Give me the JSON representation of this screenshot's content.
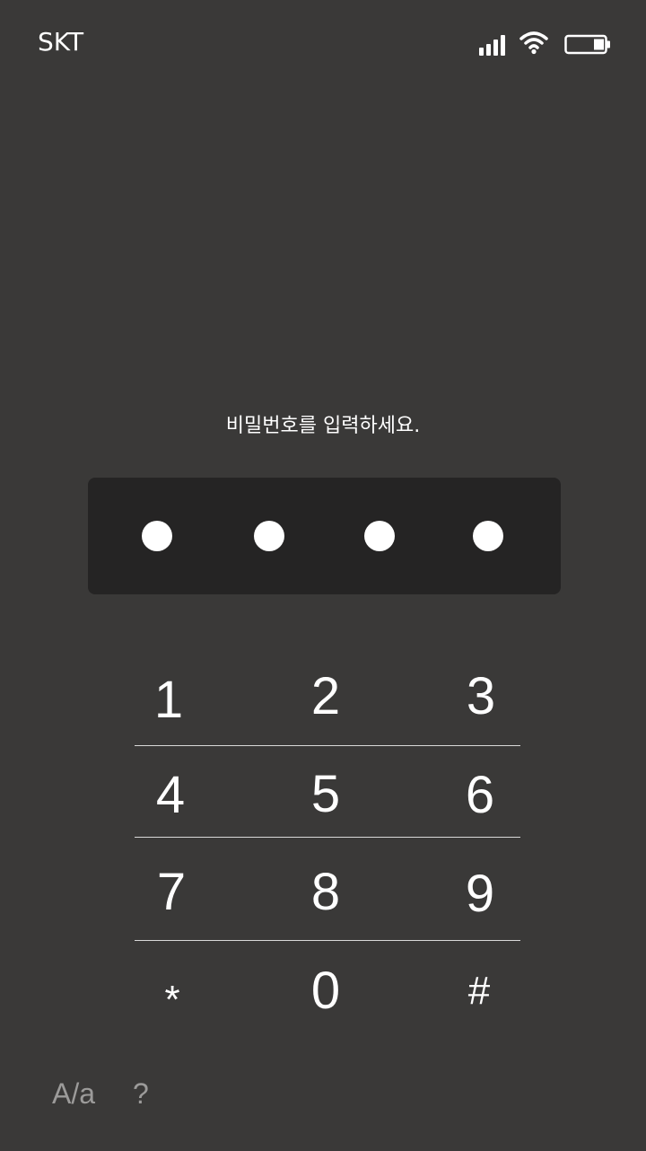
{
  "status_bar": {
    "carrier": "SKT",
    "icons": [
      "signal-icon",
      "wifi-icon",
      "battery-icon"
    ]
  },
  "lock_screen": {
    "prompt": "비밀번호를 입력하세요.",
    "entered_digit_count": 4
  },
  "keypad": {
    "keys": [
      "1",
      "2",
      "3",
      "4",
      "5",
      "6",
      "7",
      "8",
      "9",
      "*",
      "0",
      "#"
    ]
  },
  "bottom_options": {
    "case_toggle": "A/a",
    "help": "?"
  },
  "colors": {
    "background": "#3a3938",
    "pin_box": "#252424",
    "text": "#ffffff",
    "muted_text": "#9c9b9a"
  }
}
